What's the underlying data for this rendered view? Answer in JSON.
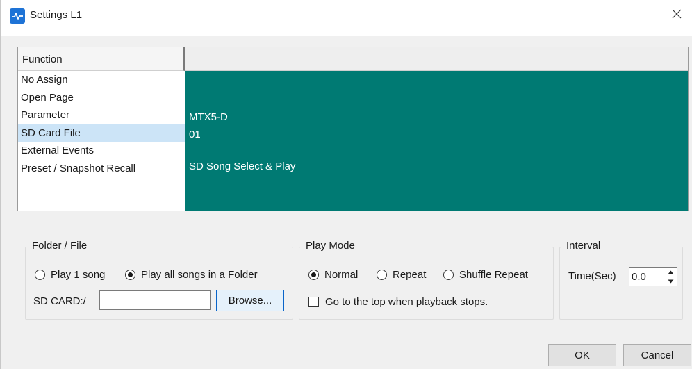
{
  "window": {
    "title": "Settings L1",
    "icon": "app-icon",
    "close_icon": "close-icon"
  },
  "function_panel": {
    "header": "Function",
    "items": [
      {
        "label": "No Assign",
        "selected": false
      },
      {
        "label": "Open Page",
        "selected": false
      },
      {
        "label": "Parameter",
        "selected": false
      },
      {
        "label": "SD Card File",
        "selected": true
      },
      {
        "label": "External Events",
        "selected": false
      },
      {
        "label": "Preset / Snapshot Recall",
        "selected": false
      }
    ],
    "detail": {
      "device": "MTX5-D",
      "number": "01",
      "action": "SD Song Select & Play",
      "background_color": "#007a73"
    }
  },
  "folder_file": {
    "label": "Folder / File",
    "options": [
      {
        "label": "Play 1 song",
        "selected": false
      },
      {
        "label": "Play all songs in a Folder",
        "selected": true
      }
    ],
    "path_label": "SD CARD:/",
    "path_value": "",
    "browse_label": "Browse..."
  },
  "play_mode": {
    "label": "Play Mode",
    "options": [
      {
        "label": "Normal",
        "selected": true
      },
      {
        "label": "Repeat",
        "selected": false
      },
      {
        "label": "Shuffle Repeat",
        "selected": false
      }
    ],
    "checkbox_label": "Go to the top when playback stops.",
    "checkbox_checked": false
  },
  "interval": {
    "label": "Interval",
    "time_label": "Time(Sec)",
    "time_value": "0.0"
  },
  "footer": {
    "ok_label": "OK",
    "cancel_label": "Cancel"
  }
}
